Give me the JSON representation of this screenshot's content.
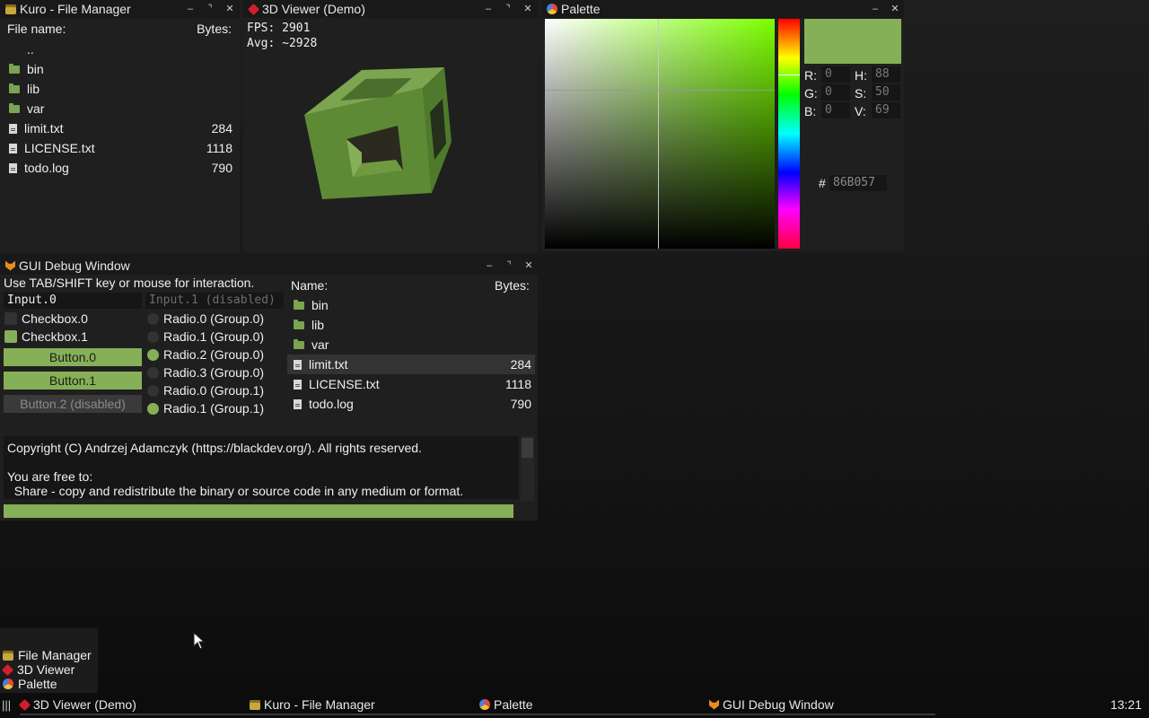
{
  "colors": {
    "accent": "#86b057",
    "cube": "#6f9a40",
    "bg": "#1f1f1f"
  },
  "file_manager": {
    "title": "Kuro - File Manager",
    "col_name": "File name:",
    "col_size": "Bytes:",
    "rows": [
      {
        "name": "..",
        "size": "",
        "icon": "none"
      },
      {
        "name": "bin",
        "size": "",
        "icon": "folder-icon"
      },
      {
        "name": "lib",
        "size": "",
        "icon": "folder-icon"
      },
      {
        "name": "var",
        "size": "",
        "icon": "folder-icon"
      },
      {
        "name": "limit.txt",
        "size": "284",
        "icon": "file-icon"
      },
      {
        "name": "LICENSE.txt",
        "size": "1118",
        "icon": "file-icon"
      },
      {
        "name": "todo.log",
        "size": "790",
        "icon": "log-file-icon"
      }
    ]
  },
  "viewer": {
    "title": "3D Viewer (Demo)",
    "fps": "FPS: 2901",
    "avg": "Avg: ~2928"
  },
  "palette": {
    "title": "Palette",
    "r_label": "R:",
    "r_value": "0",
    "g_label": "G:",
    "g_value": "0",
    "b_label": "B:",
    "b_value": "0",
    "h_label": "H:",
    "h_value": "88",
    "s_label": "S:",
    "s_value": "50",
    "v_label": "V:",
    "v_value": "69",
    "hash": "#",
    "hex": "86B057"
  },
  "debug": {
    "title": "GUI Debug Window",
    "hint": "Use TAB/SHIFT key or mouse for interaction.",
    "input0": "Input.0",
    "input1": "Input.1 (disabled)",
    "checkbox0": "Checkbox.0",
    "checkbox1": "Checkbox.1",
    "button0": "Button.0",
    "button1": "Button.1",
    "button2": "Button.2 (disabled)",
    "radios": [
      {
        "label": "Radio.0 (Group.0)",
        "checked": false
      },
      {
        "label": "Radio.1 (Group.0)",
        "checked": false
      },
      {
        "label": "Radio.2 (Group.0)",
        "checked": true
      },
      {
        "label": "Radio.3 (Group.0)",
        "checked": false
      },
      {
        "label": "Radio.0 (Group.1)",
        "checked": false
      },
      {
        "label": "Radio.1 (Group.1)",
        "checked": true
      }
    ],
    "list_col_name": "Name:",
    "list_col_size": "Bytes:",
    "list_rows": [
      {
        "name": "bin",
        "size": "",
        "icon": "folder-icon"
      },
      {
        "name": "lib",
        "size": "",
        "icon": "folder-icon"
      },
      {
        "name": "var",
        "size": "",
        "icon": "folder-icon"
      },
      {
        "name": "limit.txt",
        "size": "284",
        "icon": "file-icon",
        "selected": true
      },
      {
        "name": "LICENSE.txt",
        "size": "1118",
        "icon": "file-icon"
      },
      {
        "name": "todo.log",
        "size": "790",
        "icon": "file-icon"
      }
    ],
    "text_line1": "Copyright (C) Andrzej Adamczyk (https://blackdev.org/). All rights reserved.",
    "text_line2": "You are free to:",
    "text_line3": "  Share - copy and redistribute the binary or source code in any medium or format.",
    "progress": 1.0
  },
  "launcher": {
    "items": [
      {
        "label": "File Manager",
        "icon": "file-manager-icon"
      },
      {
        "label": "3D Viewer",
        "icon": "cube-icon"
      },
      {
        "label": "Palette",
        "icon": "palette-icon"
      }
    ]
  },
  "taskbar": {
    "menu_glyph": "|||",
    "items": [
      {
        "label": "3D Viewer (Demo)",
        "icon": "cube-icon"
      },
      {
        "label": "Kuro - File Manager",
        "icon": "file-manager-icon"
      },
      {
        "label": "Palette",
        "icon": "palette-icon"
      },
      {
        "label": "GUI Debug Window",
        "icon": "debug-icon"
      }
    ],
    "clock": "13:21"
  }
}
